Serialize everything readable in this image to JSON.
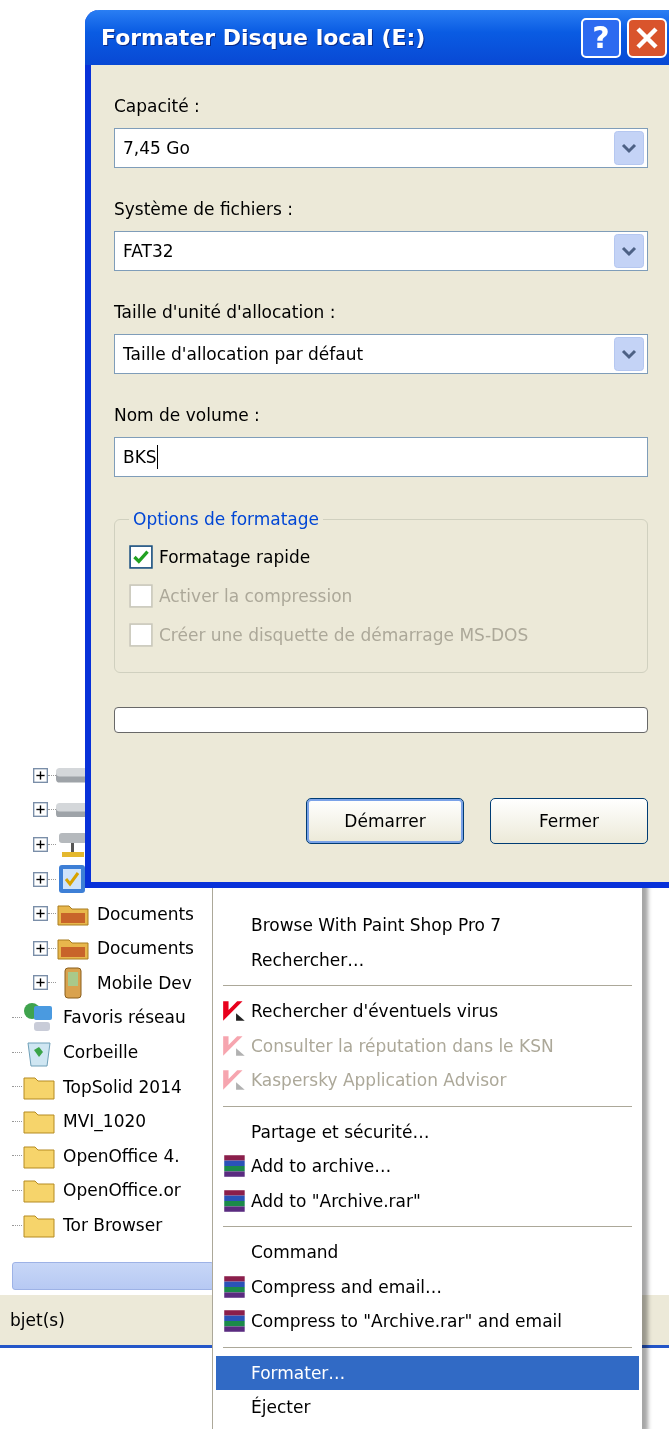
{
  "explorer": {
    "tree": {
      "sub_items": [
        {
          "kind": "drive",
          "expanded": false
        },
        {
          "kind": "drive",
          "expanded": false
        },
        {
          "kind": "network-drive",
          "expanded": false
        },
        {
          "kind": "control-panel",
          "expanded": false
        },
        {
          "kind": "shared-folder",
          "label": "Documents",
          "expanded": false
        },
        {
          "kind": "shared-folder",
          "label": "Documents",
          "expanded": false
        },
        {
          "kind": "mobile",
          "label": "Mobile Dev",
          "expanded": false
        }
      ],
      "items": [
        {
          "kind": "network",
          "label": "Favoris réseau"
        },
        {
          "kind": "recycle-bin",
          "label": "Corbeille"
        },
        {
          "kind": "folder",
          "label": "TopSolid 2014"
        },
        {
          "kind": "folder",
          "label": "MVI_1020"
        },
        {
          "kind": "folder",
          "label": "OpenOffice 4."
        },
        {
          "kind": "folder",
          "label": "OpenOffice.or"
        },
        {
          "kind": "folder",
          "label": "Tor Browser"
        }
      ]
    },
    "status_bar": {
      "text": "bjet(s)"
    }
  },
  "context_menu": {
    "groups": [
      [
        {
          "label": "Browse With Paint Shop Pro 7",
          "kind": "plain",
          "disabled": false,
          "selected": false
        },
        {
          "label": "Rechercher…",
          "kind": "plain",
          "disabled": false,
          "selected": false
        }
      ],
      [
        {
          "label": "Rechercher d'éventuels virus",
          "kind": "kaspersky",
          "disabled": false,
          "selected": false
        },
        {
          "label": "Consulter la réputation dans le KSN",
          "kind": "kaspersky",
          "disabled": true,
          "selected": false
        },
        {
          "label": "Kaspersky Application Advisor",
          "kind": "kaspersky",
          "disabled": true,
          "selected": false
        }
      ],
      [
        {
          "label": "Partage et sécurité…",
          "kind": "plain",
          "disabled": false,
          "selected": false
        },
        {
          "label": "Add to archive…",
          "kind": "winrar",
          "disabled": false,
          "selected": false
        },
        {
          "label": "Add to \"Archive.rar\"",
          "kind": "winrar",
          "disabled": false,
          "selected": false
        }
      ],
      [
        {
          "label": "Command",
          "kind": "plain",
          "disabled": false,
          "selected": false
        },
        {
          "label": "Compress and email…",
          "kind": "winrar",
          "disabled": false,
          "selected": false
        },
        {
          "label": "Compress to \"Archive.rar\" and email",
          "kind": "winrar",
          "disabled": false,
          "selected": false
        }
      ],
      [
        {
          "label": "Formater…",
          "kind": "plain",
          "disabled": false,
          "selected": true
        },
        {
          "label": "Éjecter",
          "kind": "plain",
          "disabled": false,
          "selected": false
        }
      ]
    ]
  },
  "dialog": {
    "title": "Formater Disque local (E:)",
    "help_button": "?",
    "fields": [
      {
        "kind": "combo",
        "label": "Capacité :",
        "value": "7,45 Go"
      },
      {
        "kind": "combo",
        "label": "Système de fichiers :",
        "value": "FAT32"
      },
      {
        "kind": "combo",
        "label": "Taille d'unité d'allocation :",
        "value": "Taille d'allocation par défaut"
      },
      {
        "kind": "text",
        "label": "Nom de volume :",
        "value": "BKS"
      }
    ],
    "options": {
      "title": "Options de formatage",
      "checkboxes": [
        {
          "label": "Formatage rapide",
          "checked": true,
          "disabled": false
        },
        {
          "label": "Activer la compression",
          "checked": false,
          "disabled": true
        },
        {
          "label": "Créer une disquette de démarrage MS-DOS",
          "checked": false,
          "disabled": true
        }
      ]
    },
    "progress": {
      "level": 0
    },
    "buttons": [
      {
        "label": "Démarrer",
        "default": true
      },
      {
        "label": "Fermer",
        "default": false
      }
    ]
  }
}
